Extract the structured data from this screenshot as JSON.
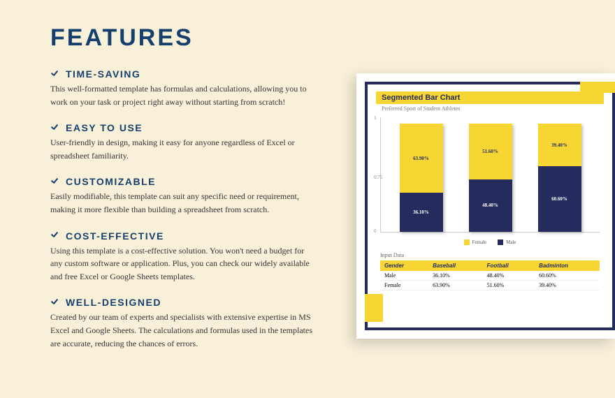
{
  "heading": "FEATURES",
  "features": [
    {
      "title": "TIME-SAVING",
      "desc": "This well-formatted template has formulas and calculations, allowing you to work on your task or project right away without starting from scratch!"
    },
    {
      "title": "EASY TO USE",
      "desc": "User-friendly in design, making it easy for anyone regardless of Excel or spreadsheet familiarity."
    },
    {
      "title": "CUSTOMIZABLE",
      "desc": "Easily modifiable, this template can suit any specific need or requirement, making it more flexible than building a spreadsheet from scratch."
    },
    {
      "title": "COST-EFFECTIVE",
      "desc": "Using this template is a cost-effective solution. You won't need a budget for any custom software or application. Plus, you can check our widely available and free Excel or Google Sheets templates."
    },
    {
      "title": "WELL-DESIGNED",
      "desc": "Created by our team of experts and specialists with extensive expertise in MS Excel and Google Sheets. The calculations and formulas used in the templates are accurate, reducing the chances of errors."
    }
  ],
  "preview": {
    "chart_title": "Segmented Bar Chart",
    "chart_sub": "Preferred Sport of Student Athletes",
    "legend_female": "Female",
    "legend_male": "Male",
    "input_label": "Input Data",
    "table": {
      "headers": [
        "Gender",
        "Baseball",
        "Football",
        "Badminton"
      ],
      "rows": [
        [
          "Male",
          "36.10%",
          "48.40%",
          "60.60%"
        ],
        [
          "Female",
          "63.90%",
          "51.60%",
          "39.40%"
        ]
      ]
    }
  },
  "chart_data": {
    "type": "bar",
    "stacked": true,
    "categories": [
      "Baseball",
      "Football",
      "Badminton"
    ],
    "series": [
      {
        "name": "Female",
        "values": [
          63.9,
          51.6,
          39.4
        ]
      },
      {
        "name": "Male",
        "values": [
          36.1,
          48.4,
          60.6
        ]
      }
    ],
    "title": "Segmented Bar Chart",
    "subtitle": "Preferred Sport of Student Athletes",
    "ylabel": "",
    "xlabel": "",
    "ylim": [
      0,
      1
    ],
    "yticks": [
      "1",
      "0.75",
      "0"
    ]
  }
}
